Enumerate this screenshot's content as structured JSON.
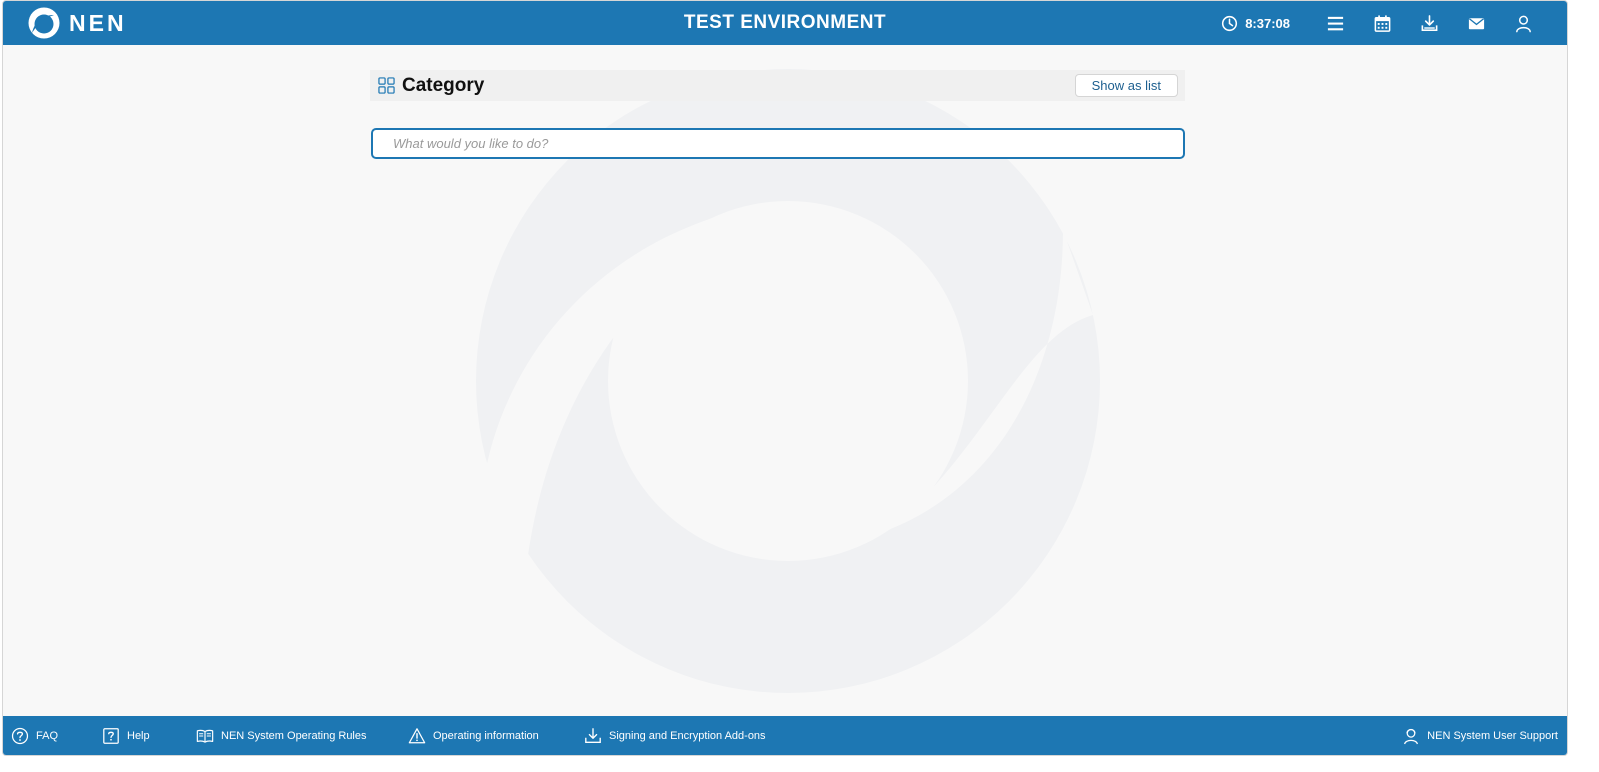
{
  "header": {
    "logo_text": "NEN",
    "env_title": "TEST ENVIRONMENT",
    "clock_time": "8:37:08",
    "icons": [
      "clock-icon",
      "menu-icon",
      "calendar-icon",
      "download-icon",
      "mail-icon",
      "user-icon"
    ]
  },
  "category": {
    "title": "Category",
    "show_as_list": "Show as list"
  },
  "search": {
    "placeholder": "What would you like to do?"
  },
  "footer": {
    "faq": "FAQ",
    "help": "Help",
    "rules": "NEN System Operating Rules",
    "operating_info": "Operating information",
    "addons": "Signing and Encryption Add-ons",
    "support": "NEN System User Support"
  },
  "colors": {
    "brand": "#1d77b3",
    "background": "#f8f8f8",
    "watermark": "#f0f1f3"
  }
}
